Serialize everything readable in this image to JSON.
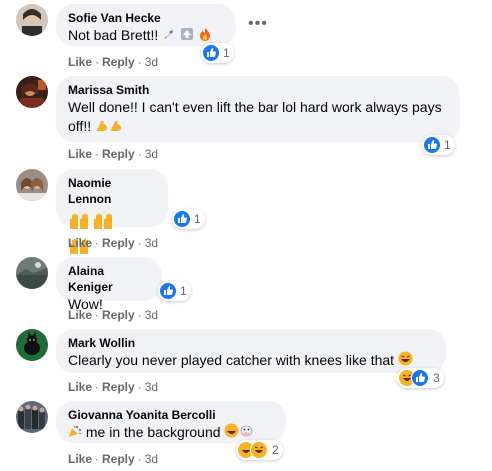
{
  "comments": [
    {
      "name": "Sofie Van Hecke",
      "text": "Not bad Brett!!",
      "reaction_count": "1",
      "actions": {
        "like": "Like",
        "reply": "Reply",
        "time": "3d"
      }
    },
    {
      "name": "Marissa Smith",
      "text": "Well done!! I can't even lift the bar lol hard work always pays off!!",
      "reaction_count": "1",
      "actions": {
        "like": "Like",
        "reply": "Reply",
        "time": "3d"
      }
    },
    {
      "name": "Naomie Lennon",
      "text": "",
      "reaction_count": "1",
      "actions": {
        "like": "Like",
        "reply": "Reply",
        "time": "3d"
      }
    },
    {
      "name": "Alaina Keniger",
      "text": "Wow!",
      "reaction_count": "1",
      "actions": {
        "like": "Like",
        "reply": "Reply",
        "time": "3d"
      }
    },
    {
      "name": "Mark Wollin",
      "text": "Clearly you never played catcher with knees like that",
      "reaction_count": "3",
      "actions": {
        "like": "Like",
        "reply": "Reply",
        "time": "3d"
      }
    },
    {
      "name": "Giovanna Yoanita Bercolli",
      "text": "me in the background",
      "reaction_count": "2",
      "actions": {
        "like": "Like",
        "reply": "Reply",
        "time": "3d"
      }
    }
  ],
  "colors": {
    "bubble": "#f0f2f5",
    "like_blue": "#1877f2",
    "meta_gray": "#65676b"
  },
  "icons": [
    "like-icon",
    "haha-icon",
    "rocket-emoji",
    "arrow-emoji",
    "fire-emoji",
    "muscle-emoji",
    "raising-hands-emoji",
    "party-emoji",
    "more-options-icon"
  ]
}
